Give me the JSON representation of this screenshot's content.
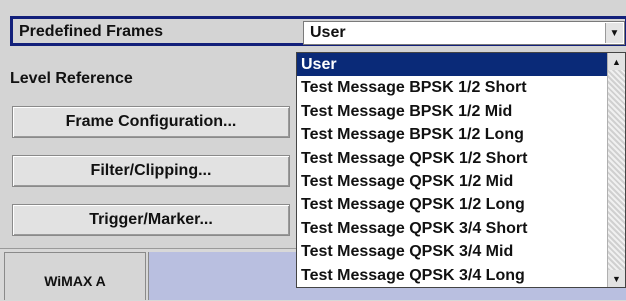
{
  "predefined_frames": {
    "label": "Predefined Frames",
    "value": "User"
  },
  "level_reference": {
    "label": "Level Reference"
  },
  "buttons": {
    "frame_configuration": "Frame Configuration...",
    "filter_clipping": "Filter/Clipping...",
    "trigger_marker": "Trigger/Marker..."
  },
  "tabs": {
    "wimax": "WiMAX A"
  },
  "dropdown": {
    "items": [
      "User",
      "Test Message BPSK 1/2 Short",
      "Test Message BPSK 1/2 Mid",
      "Test Message BPSK 1/2 Long",
      "Test Message QPSK 1/2 Short",
      "Test Message QPSK 1/2 Mid",
      "Test Message QPSK 1/2 Long",
      "Test Message QPSK 3/4 Short",
      "Test Message QPSK 3/4 Mid",
      "Test Message QPSK 3/4 Long"
    ],
    "selected_index": 0
  },
  "icons": {
    "combo_arrow": "chevron-down-icon",
    "scroll_up": "arrow-up-icon",
    "scroll_down": "arrow-down-icon"
  },
  "colors": {
    "focus_border": "#12207a",
    "selection": "#0a2a78",
    "tab_area": "#b9bfe0"
  }
}
